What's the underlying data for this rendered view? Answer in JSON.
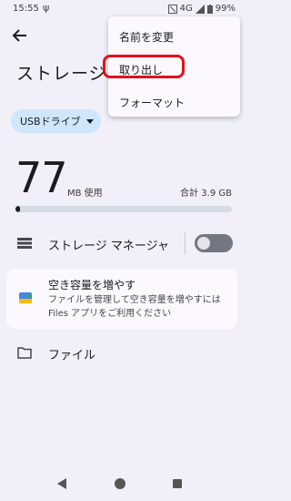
{
  "status_bar": {
    "time": "15:55",
    "network": "4G",
    "battery": "99%"
  },
  "page": {
    "title": "ストレージ",
    "volume_chip": "USBドライブ"
  },
  "usage": {
    "used_value": "77",
    "used_unit": "MB 使用",
    "total_label": "合計 3.9 GB",
    "fill_fraction": 0.02
  },
  "storage_manager": {
    "label": "ストレージ マネージャ",
    "enabled": false
  },
  "free_up_card": {
    "title": "空き容量を増やす",
    "text": "ファイルを管理して空き容量を増やすには Files アプリをご利用ください"
  },
  "files_row": {
    "label": "ファイル"
  },
  "menu": {
    "items": [
      "名前を変更",
      "取り出し",
      "フォーマット"
    ]
  },
  "colors": {
    "highlight": "#e5101c",
    "chip_bg": "#cfe6fb"
  }
}
